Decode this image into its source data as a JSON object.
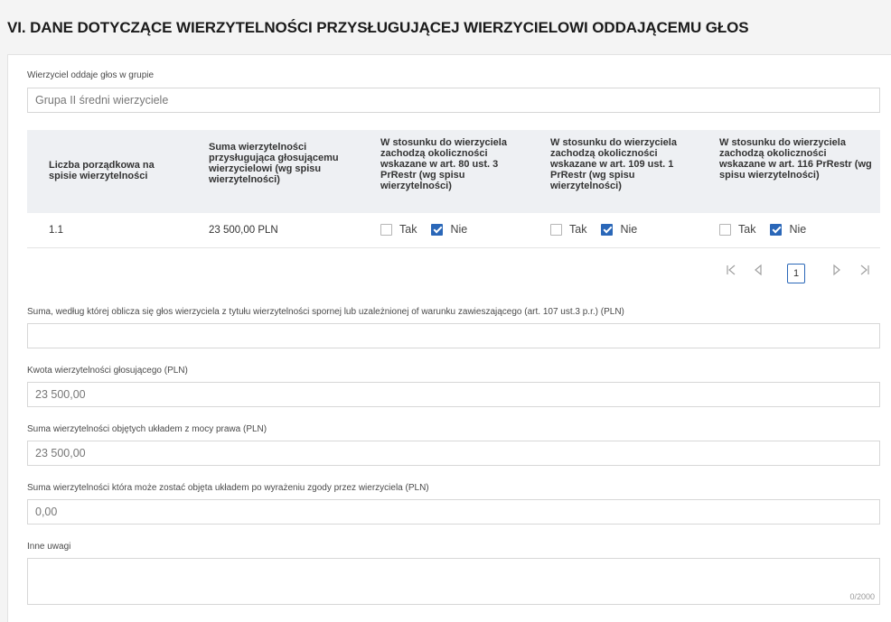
{
  "section": {
    "title": "VI. DANE DOTYCZĄCE WIERZYTELNOŚCI PRZYSŁUGUJĄCEJ WIERZYCIELOWI ODDAJĄCEMU GŁOS"
  },
  "group": {
    "label": "Wierzyciel oddaje głos w grupie",
    "placeholder": "Grupa II średni wierzyciele"
  },
  "table": {
    "headers": [
      "Liczba porządkowa na spisie wierzytelności",
      "Suma wierzytelności przysługująca głosującemu wierzycielowi (wg spisu wierzytelności)",
      "W stosunku do wierzyciela zachodzą okoliczności wskazane w art. 80 ust. 3 PrRestr (wg spisu wierzytelności)",
      "W stosunku do wierzyciela zachodzą okoliczności wskazane w art. 109 ust. 1 PrRestr (wg spisu wierzytelności)",
      "W stosunku do wierzyciela zachodzą okoliczności wskazane w art. 116 PrRestr (wg spisu wierzytelności)"
    ],
    "rows": [
      {
        "number": "1.1",
        "amount": "23 500,00 PLN",
        "art80": {
          "tak": false,
          "nie": true
        },
        "art109": {
          "tak": false,
          "nie": true
        },
        "art116": {
          "tak": false,
          "nie": true
        }
      }
    ],
    "option_yes": "Tak",
    "option_no": "Nie"
  },
  "pagination": {
    "current_page": "1"
  },
  "fields": {
    "disputed_label": "Suma, według której oblicza się głos wierzyciela z tytułu wierzytelności spornej lub uzależnionej of warunku zawieszającego (art. 107 ust.3 p.r.) (PLN)",
    "disputed_value": "",
    "voter_amount_label": "Kwota wierzytelności głosującego (PLN)",
    "voter_amount_placeholder": "23 500,00",
    "by_law_label": "Suma wierzytelności objętych układem z mocy prawa (PLN)",
    "by_law_placeholder": "23 500,00",
    "by_consent_label": "Suma wierzytelności która może zostać objęta układem po wyrażeniu zgody przez wierzyciela (PLN)",
    "by_consent_placeholder": "0,00",
    "remarks_label": "Inne uwagi",
    "remarks_counter": "0/2000"
  },
  "icons": {
    "first": "first-page-icon",
    "prev": "prev-page-icon",
    "next": "next-page-icon",
    "last": "last-page-icon",
    "check": "checkmark-icon"
  },
  "colors": {
    "accent": "#2a67b8",
    "header_bg": "#eef0f3"
  }
}
